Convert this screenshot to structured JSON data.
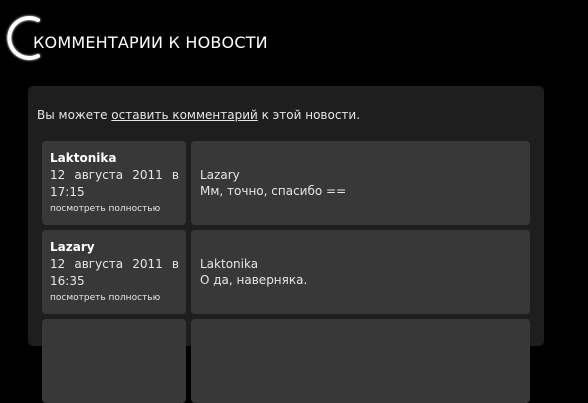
{
  "header": {
    "title": "КОММЕНТАРИИ К НОВОСТИ",
    "ring_icon": "crescent-ring-icon",
    "ring_color": "#ffffff"
  },
  "intro": {
    "prefix": "Вы можете ",
    "link": "оставить комментарий",
    "suffix": " к этой новости."
  },
  "comments": [
    {
      "author": "Laktonika",
      "date": "12 августа 2011 в",
      "time": "17:15",
      "more": "посмотреть полностью",
      "reply_to": "Lazary",
      "text": "Мм, точно, спасибо =="
    },
    {
      "author": "Lazary",
      "date": "12 августа 2011 в",
      "time": "16:35",
      "more": "посмотреть полностью",
      "reply_to": "Laktonika",
      "text": "О да, наверняка."
    },
    {
      "author": "",
      "date": "",
      "time": "",
      "more": "",
      "reply_to": "",
      "text": ""
    }
  ],
  "colors": {
    "background": "#000000",
    "panel": "#1e1e1e",
    "box": "#383838",
    "text": "#e6e6e6"
  }
}
